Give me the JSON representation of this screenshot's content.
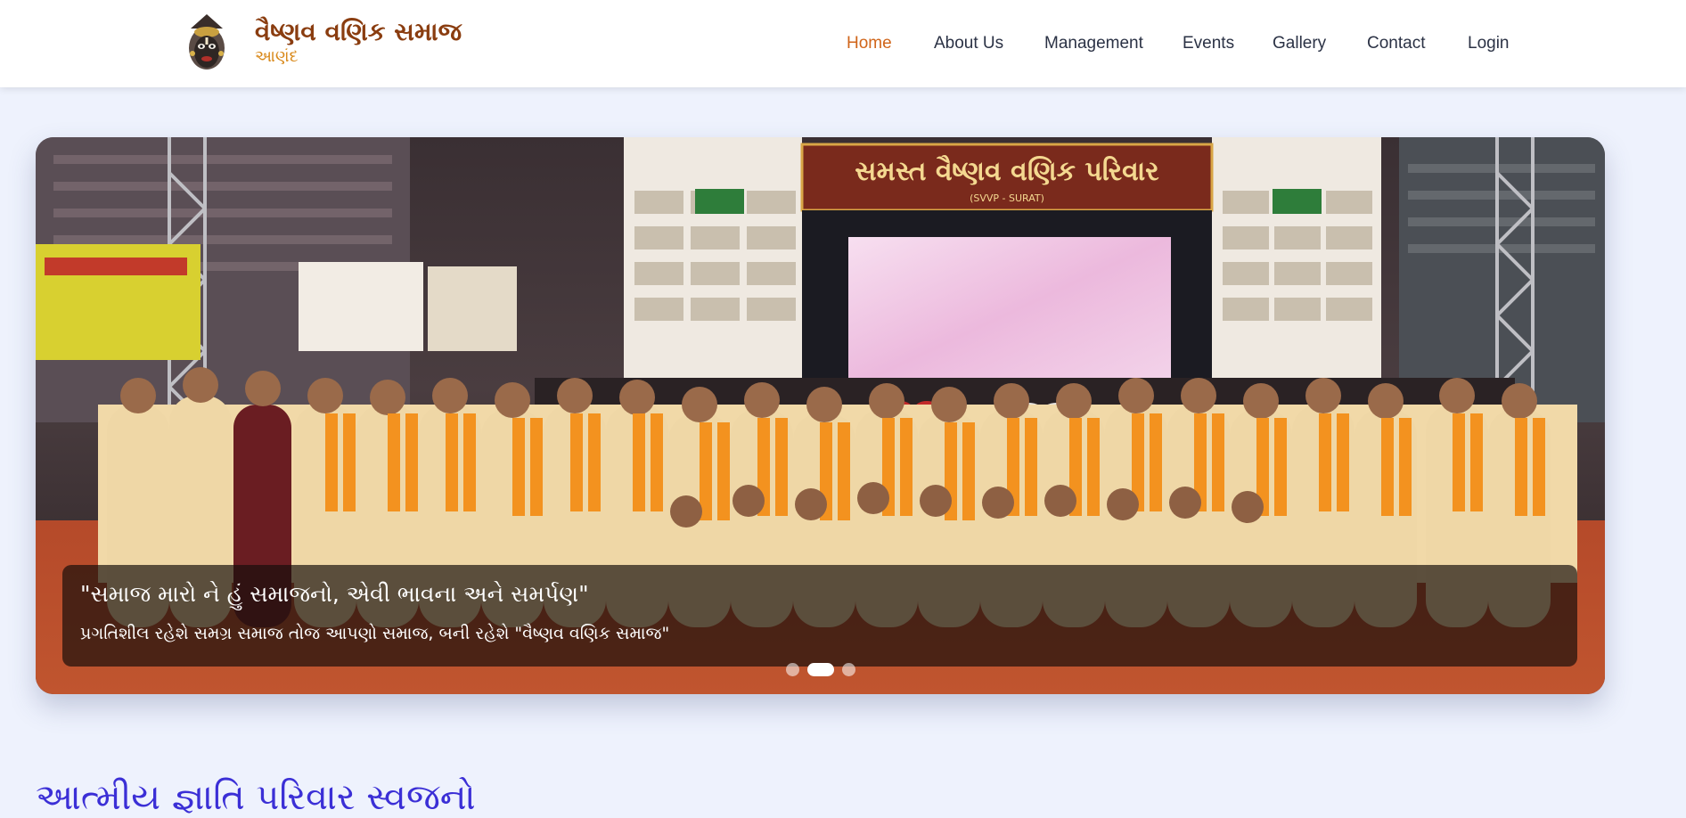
{
  "brand": {
    "title": "વૈષ્ણવ વણિક સમાજ",
    "subtitle": "આણંદ",
    "logo_icon": "deity-logo-icon"
  },
  "nav": {
    "items": [
      {
        "label": "Home",
        "active": true
      },
      {
        "label": "About Us",
        "active": false
      },
      {
        "label": "Management",
        "active": false
      },
      {
        "label": "Events",
        "active": false
      },
      {
        "label": "Gallery",
        "active": false
      },
      {
        "label": "Contact",
        "active": false
      },
      {
        "label": "Login",
        "active": false
      }
    ]
  },
  "hero": {
    "banner_text": "સમસ્ત વૈષ્ણવ વણિક પરિવાર",
    "banner_sub": "(SVVP - SURAT)",
    "caption_title": "\"સમાજ મારો ને હું સમાજનો, એવી ભાવના અને સમર્પણ\"",
    "caption_text": "પ્રગતિશીલ રહેશે સમગ્ર સમાજ તોજ આપણો સમાજ, બની રહેશે \"વૈષ્ણવ વણિક સમાજ\"",
    "slides_total": 3,
    "active_slide": 2
  },
  "section": {
    "heading": "આત્મીય જ્ઞાતિ પરિવાર સ્વજનો"
  },
  "colors": {
    "brand": "#8a3d10",
    "brand_sub": "#d98a1c",
    "nav_active": "#d0651a",
    "nav_text": "#2b3245",
    "page_bg": "#eef2fd",
    "heading": "#3b2fd6"
  }
}
